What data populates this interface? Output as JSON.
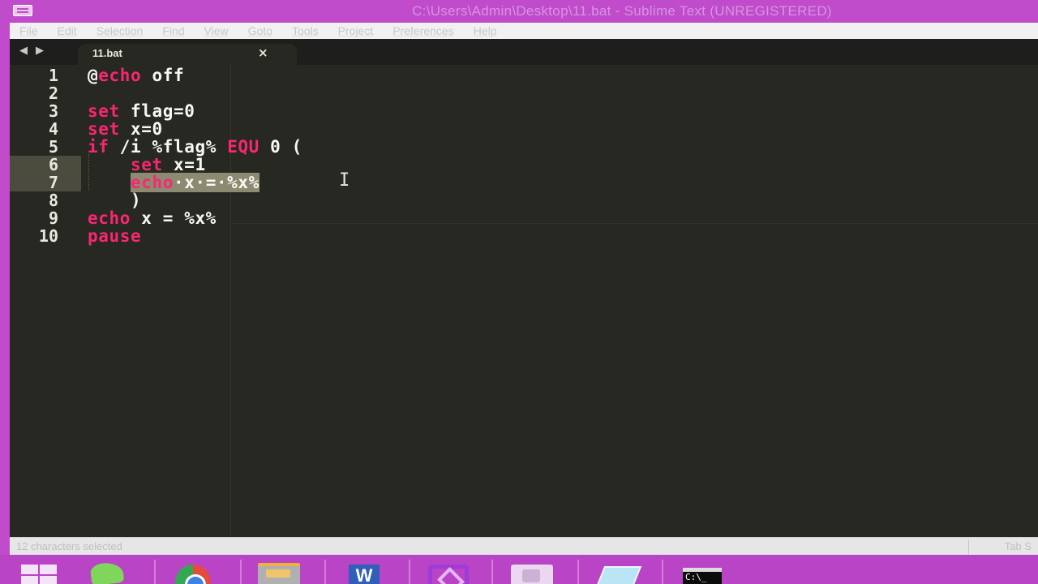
{
  "window": {
    "title": "C:\\Users\\Admin\\Desktop\\11.bat - Sublime Text (UNREGISTERED)"
  },
  "menu": {
    "items": [
      "File",
      "Edit",
      "Selection",
      "Find",
      "View",
      "Goto",
      "Tools",
      "Project",
      "Preferences",
      "Help"
    ]
  },
  "tabs": {
    "nav_back": "◀",
    "nav_forward": "▶",
    "active": {
      "label": "11.bat",
      "close": "×"
    }
  },
  "editor": {
    "line_numbers": [
      "1",
      "2",
      "3",
      "4",
      "5",
      "6",
      "7",
      "8",
      "9",
      "10"
    ],
    "lines": [
      [
        {
          "t": "@",
          "c": "plain"
        },
        {
          "t": "echo",
          "c": "kw"
        },
        {
          "t": " off",
          "c": "plain"
        }
      ],
      [],
      [
        {
          "t": "set",
          "c": "kw"
        },
        {
          "t": " flag=0",
          "c": "plain"
        }
      ],
      [
        {
          "t": "set",
          "c": "kw"
        },
        {
          "t": " x=0",
          "c": "plain"
        }
      ],
      [
        {
          "t": "if",
          "c": "kw"
        },
        {
          "t": " /i %flag% ",
          "c": "plain"
        },
        {
          "t": "EQU",
          "c": "kw"
        },
        {
          "t": " 0 (",
          "c": "plain"
        }
      ],
      [
        {
          "t": "    ",
          "c": "plain"
        },
        {
          "t": "set",
          "c": "kw"
        },
        {
          "t": " x=1",
          "c": "plain"
        }
      ],
      [
        {
          "t": "    ",
          "c": "plain"
        },
        {
          "t": "echo",
          "c": "kw sel"
        },
        {
          "t": "·x·=·%x%",
          "c": "plain sel"
        }
      ],
      [
        {
          "t": "    )",
          "c": "plain"
        }
      ],
      [
        {
          "t": "echo",
          "c": "kw"
        },
        {
          "t": " x = %x%",
          "c": "plain"
        }
      ],
      [
        {
          "t": "pause",
          "c": "kw"
        }
      ]
    ],
    "highlighted_lines": [
      6,
      7
    ],
    "cursor_glyph": "I"
  },
  "status": {
    "left": "12 characters selected",
    "right": "Tab S"
  },
  "taskbar": {
    "items": [
      "start",
      "bird",
      "chrome",
      "files",
      "word",
      "visual-studio",
      "camera",
      "paper",
      "command-prompt"
    ],
    "word_letter": "W",
    "cmd_text": "C:\\_"
  },
  "colors": {
    "chrome_bg": "#c04ccc",
    "editor_bg": "#272822",
    "keyword": "#f92672",
    "text": "#f8f8f2",
    "selection": "#8c8b72"
  }
}
